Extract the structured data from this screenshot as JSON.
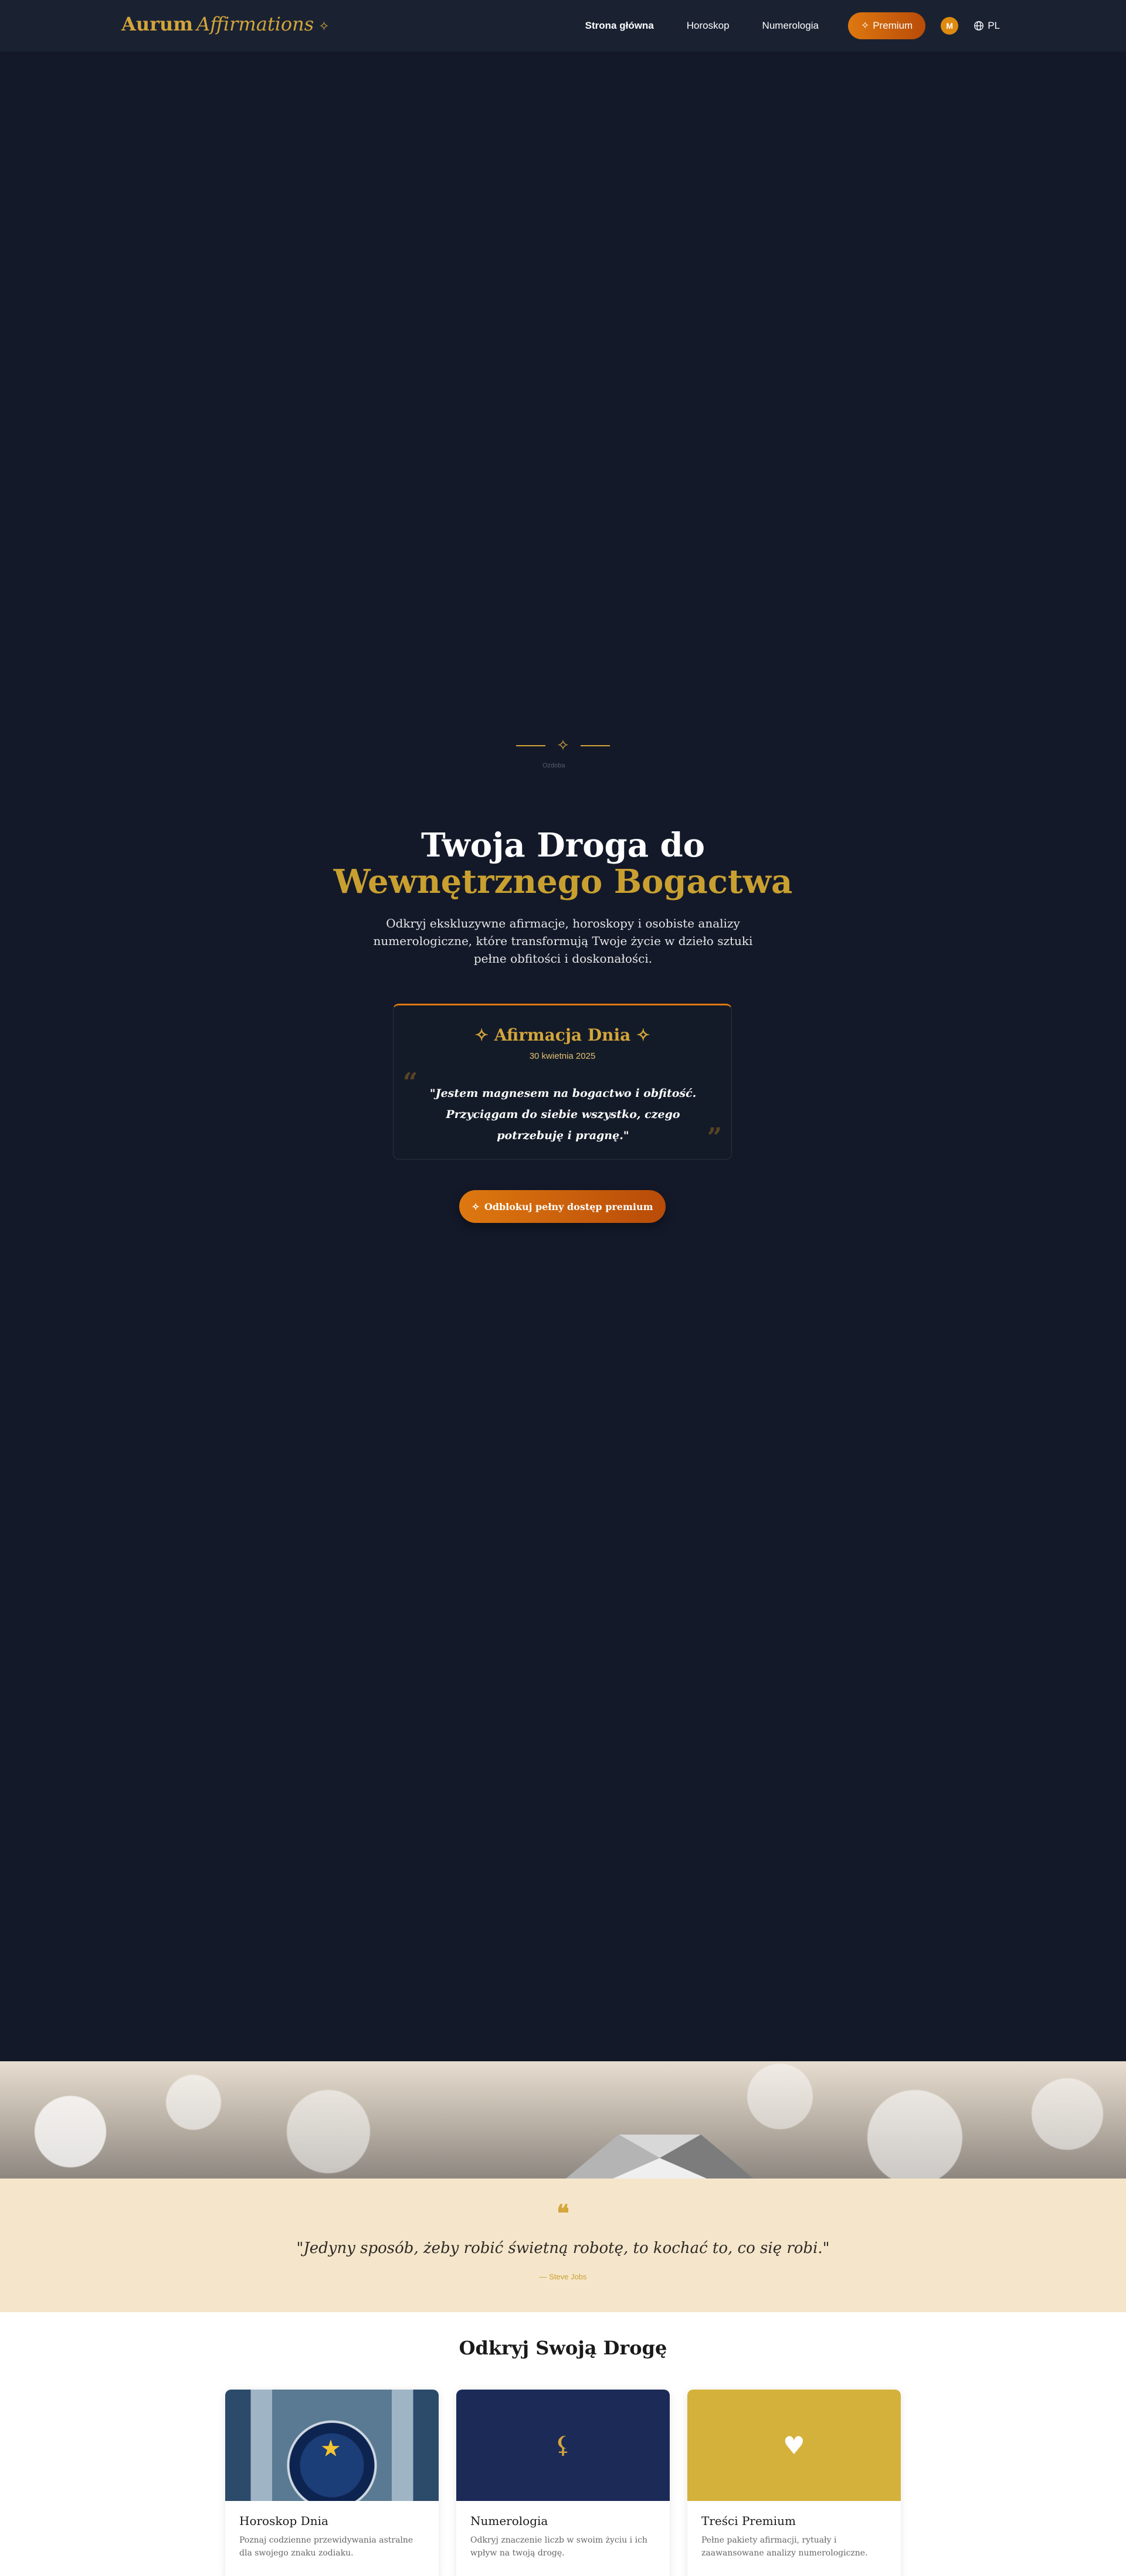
{
  "nav": {
    "logo_bold": "Aurum",
    "logo_italic": "Affirmations",
    "logo_icon": "sparkle-icon",
    "links": [
      {
        "label": "Strona główna",
        "active": true
      },
      {
        "label": "Horoskop",
        "active": false
      },
      {
        "label": "Numerologia",
        "active": false
      }
    ],
    "premium_label": "Premium",
    "avatar_initial": "M",
    "language": "PL"
  },
  "hero": {
    "broken_image_alt": "Ozdoba",
    "title_line1": "Twoja Droga do",
    "title_line2": "Wewnętrznego Bogactwa",
    "subtitle": "Odkryj ekskluzywne afirmacje, horoskopy i osobiste analizy numerologiczne, które transformują Twoje życie w dzieło sztuki pełne obfitości i doskonałości.",
    "affirmation": {
      "title": "Afirmacja Dnia",
      "date": "30 kwietnia 2025",
      "text": "\"Jestem magnesem na bogactwo i obfitość. Przyciągam do siebie wszystko, czego potrzebuję i pragnę.\""
    },
    "cta_label": "Odblokuj pełny dostęp premium"
  },
  "quote": {
    "text": "\"Jedyny sposób, żeby robić świetną robotę, to kochać to, co się robi.\"",
    "author": "— Steve Jobs"
  },
  "features": {
    "title": "Odkryj Swoją Drogę",
    "cards": [
      {
        "title": "Horoskop Dnia",
        "description": "Poznaj codzienne przewidywania astralne dla swojego znaku zodiaku.",
        "icon": "zodiac-clock-image"
      },
      {
        "title": "Numerologia",
        "description": "Odkryj znaczenie liczb w swoim życiu i ich wpływ na twoją drogę.",
        "icon": "numerology-icon"
      },
      {
        "title": "Treści Premium",
        "description": "Pełne pakiety afirmacji, rytuały i zaawansowane analizy numerologiczne.",
        "icon": "heart-icon"
      }
    ]
  },
  "colors": {
    "background": "#131929",
    "gold": "#d4a53a",
    "accent_orange": "#de7810",
    "quote_bg": "#f5e6cb"
  }
}
